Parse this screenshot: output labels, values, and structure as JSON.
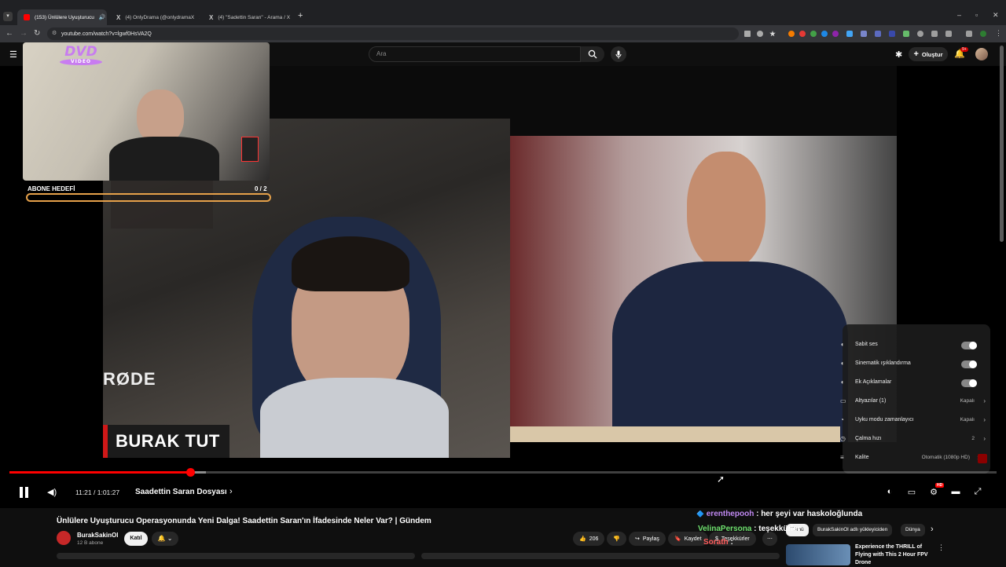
{
  "browser": {
    "tabs": [
      {
        "label": "(153) Ünlülere Uyuşturucu",
        "active": true,
        "color": "#ff0000"
      },
      {
        "label": "(4) OnlyDrama (@onlydramaX",
        "active": false,
        "color": "#ffffff"
      },
      {
        "label": "(4) \"Sadettin Saran\" - Arama / X",
        "active": false,
        "color": "#ffffff"
      }
    ],
    "url": "youtube.com/watch?v=lgwf0HsVA2Q",
    "new_tab": "+"
  },
  "header": {
    "search_placeholder": "Ara",
    "create_label": "Oluştur",
    "notif_count": "9+"
  },
  "overlay": {
    "dvd_text": "DVD",
    "dvd_sub": "VIDEO",
    "goal_label": "ABONE HEDEFİ",
    "goal_count": "0  / 2",
    "goal_fraction": 0,
    "name_tag": "BURAK TUT",
    "mic_brand": "RØDE"
  },
  "settings_menu": [
    {
      "label": "Sabit ses",
      "type": "toggle"
    },
    {
      "label": "Sinematik ışıklandırma",
      "type": "toggle"
    },
    {
      "label": "Ek Açıklamalar",
      "type": "toggle"
    },
    {
      "label": "Altyazılar (1)",
      "value": "Kapalı"
    },
    {
      "label": "Uyku modu zamanlayıcı",
      "value": "Kapalı"
    },
    {
      "label": "Çalma hızı",
      "value": "2"
    },
    {
      "label": "Kalite",
      "value": "Otomatik (1080p HD)"
    }
  ],
  "player": {
    "time": "11:21 / 1:01:27",
    "chapter": "Saadettin Saran Dosyası",
    "played_fraction": 0.183,
    "buffered_fraction": 0.199
  },
  "video": {
    "title": "Ünlülere Uyuşturucu Operasyonunda Yeni Dalga! Saadettin Saran'ın İfadesinde Neler Var? | Gündem",
    "channel": "BurakSakinOl",
    "subscribers": "12 B abone",
    "join_label": "Katıl",
    "likes": "206",
    "share_label": "Paylaş",
    "save_label": "Kaydet",
    "thanks_label": "Teşekkürler"
  },
  "chips": [
    "Tümü",
    "BurakSakinOl adlı yükleyiciden",
    "Dünya"
  ],
  "chat": [
    {
      "user": "erenthepooh",
      "msg": "her şeyi var haskoloğlunda",
      "color": "#c089f2"
    },
    {
      "user": "VelinaPersona",
      "msg": "teşekkürler",
      "color": "#6ee06e"
    },
    {
      "user": "Sorath",
      "msg": "",
      "color": "#ff5b5b"
    }
  ],
  "recommendation": {
    "title": "Experience the THRILL of Flying with This 2 Hour FPV Drone"
  },
  "colors": {
    "accent": "#ff0000",
    "goal_bar": "#e6a14a"
  }
}
